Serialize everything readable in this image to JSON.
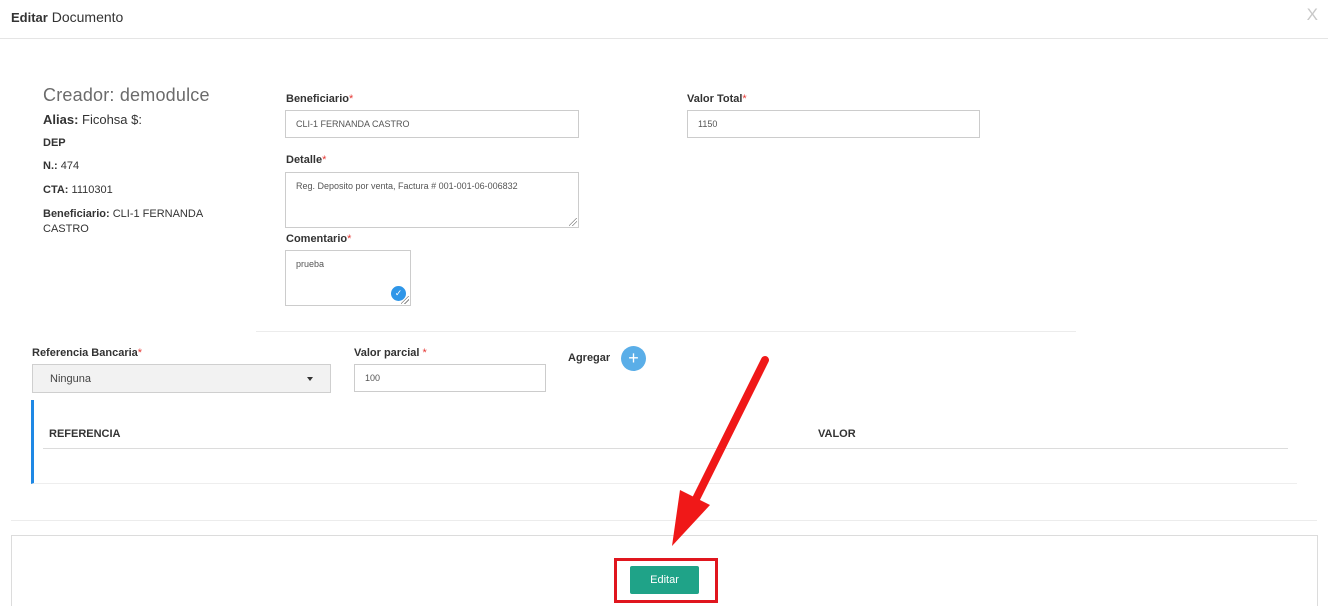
{
  "header": {
    "title_bold": "Editar",
    "title_rest": " Documento",
    "close_label": "X"
  },
  "info": {
    "creator": "Creador: demodulce",
    "alias_label": "Alias:",
    "alias_value": " Ficohsa $:",
    "dep": "DEP",
    "num_label": "N.:",
    "num_value": " 474",
    "cta_label": "CTA:",
    "cta_value": " 1110301",
    "benef_label": "Beneficiario:",
    "benef_value": " CLI-1   FERNANDA CASTRO"
  },
  "form": {
    "beneficiario_label": "Beneficiario",
    "beneficiario_value": "CLI-1   FERNANDA CASTRO",
    "valor_total_label": "Valor Total",
    "valor_total_value": "1150",
    "detalle_label": "Detalle",
    "detalle_value": "Reg. Deposito por venta, Factura # 001-001-06-006832",
    "comentario_label": "Comentario",
    "comentario_value": "prueba",
    "required_mark": "*"
  },
  "referencia": {
    "label": "Referencia Bancaria",
    "selected": "Ninguna",
    "valor_parcial_label": "Valor parcial ",
    "valor_parcial_value": "100",
    "agregar_label": "Agregar",
    "add_symbol": "+"
  },
  "table": {
    "columns": [
      "REFERENCIA",
      "VALOR"
    ],
    "rows": []
  },
  "footer": {
    "edit_label": "Editar"
  },
  "colors": {
    "accent_blue": "#1e88e5",
    "edit_green": "#1fa388",
    "highlight_red": "#e0161e"
  },
  "icons": [
    "close-icon",
    "check-circle-icon",
    "plus-icon",
    "caret-down-icon",
    "annotation-arrow"
  ]
}
